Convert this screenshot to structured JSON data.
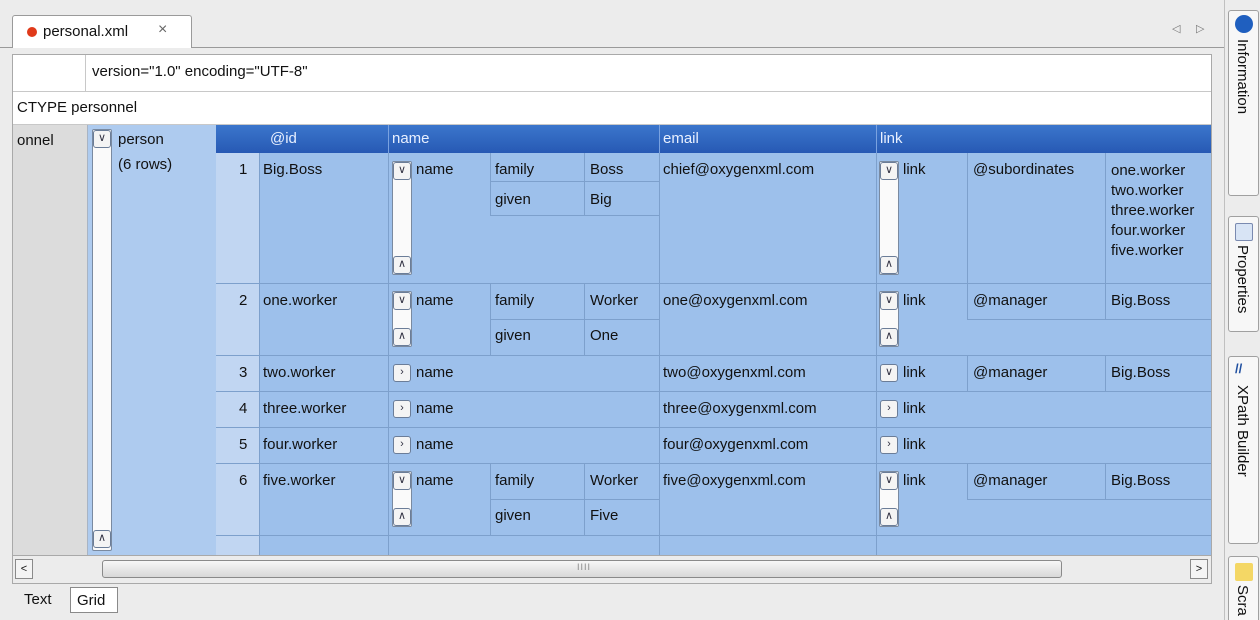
{
  "editor": {
    "tab_label": "personal.xml",
    "tab_close": "×",
    "nav_left": "◁",
    "nav_right": "▷"
  },
  "grid": {
    "pi_text": "version=\"1.0\" encoding=\"UTF-8\"",
    "doctype_text": "CTYPE personnel",
    "root_label": "onnel",
    "person_label": "person",
    "person_rows": "(6 rows)",
    "headers": {
      "id": "@id",
      "name": "name",
      "email": "email",
      "link": "link"
    },
    "rows": [
      {
        "num": "1",
        "id": "Big.Boss",
        "name_label": "name",
        "family_label": "family",
        "family": "Boss",
        "given_label": "given",
        "given": "Big",
        "email": "chief@oxygenxml.com",
        "link_label": "link",
        "link_attr": "@subordinates",
        "link_values": [
          "one.worker",
          "two.worker",
          "three.worker",
          "four.worker",
          "five.worker"
        ]
      },
      {
        "num": "2",
        "id": "one.worker",
        "name_label": "name",
        "family_label": "family",
        "family": "Worker",
        "given_label": "given",
        "given": "One",
        "email": "one@oxygenxml.com",
        "link_label": "link",
        "link_attr": "@manager",
        "link_value": "Big.Boss"
      },
      {
        "num": "3",
        "id": "two.worker",
        "name_label": "name",
        "email": "two@oxygenxml.com",
        "link_label": "link",
        "link_attr": "@manager",
        "link_value": "Big.Boss"
      },
      {
        "num": "4",
        "id": "three.worker",
        "name_label": "name",
        "email": "three@oxygenxml.com",
        "link_label": "link"
      },
      {
        "num": "5",
        "id": "four.worker",
        "name_label": "name",
        "email": "four@oxygenxml.com",
        "link_label": "link"
      },
      {
        "num": "6",
        "id": "five.worker",
        "name_label": "name",
        "family_label": "family",
        "family": "Worker",
        "given_label": "given",
        "given": "Five",
        "email": "five@oxygenxml.com",
        "link_label": "link",
        "link_attr": "@manager",
        "link_value": "Big.Boss"
      }
    ]
  },
  "icons": {
    "collapse": "chevron-down-icon",
    "expand": "chevron-right-icon",
    "collapse_up": "chevron-up-icon"
  },
  "scroll": {
    "left": "<",
    "right": ">",
    "grip": "IIII"
  },
  "modes": {
    "text": "Text",
    "grid": "Grid"
  },
  "side_panels": {
    "information": "Information",
    "properties": "Properties",
    "xpath_builder": "XPath Builder",
    "scratch": "Scra"
  },
  "colors": {
    "header": "#2f66c0",
    "row_bg": "#9dc0eb",
    "tab_dot": "#e03a1a"
  }
}
